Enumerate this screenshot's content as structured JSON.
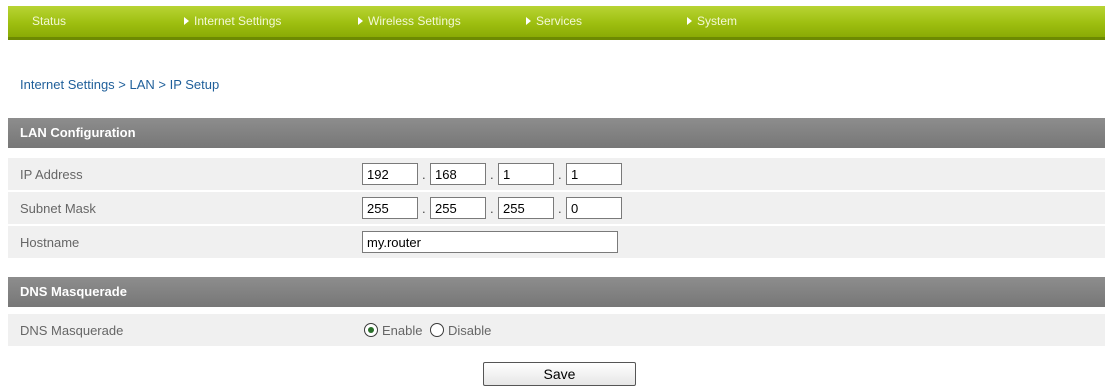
{
  "nav": {
    "items": [
      {
        "label": "Status"
      },
      {
        "label": "Internet Settings"
      },
      {
        "label": "Wireless Settings"
      },
      {
        "label": "Services"
      },
      {
        "label": "System"
      }
    ]
  },
  "breadcrumb": "Internet Settings > LAN > IP Setup",
  "lan": {
    "header": "LAN Configuration",
    "ip_label": "IP Address",
    "ip": [
      "192",
      "168",
      "1",
      "1"
    ],
    "mask_label": "Subnet Mask",
    "mask": [
      "255",
      "255",
      "255",
      "0"
    ],
    "hostname_label": "Hostname",
    "hostname": "my.router"
  },
  "dns": {
    "header": "DNS Masquerade",
    "label": "DNS Masquerade",
    "enable_label": "Enable",
    "disable_label": "Disable",
    "selected": "Enable"
  },
  "save_label": "Save",
  "colors": {
    "nav_green": "#9ebf10",
    "section_gray": "#808080",
    "row_bg": "#f0f0f0",
    "link_blue": "#1f5f9a"
  }
}
